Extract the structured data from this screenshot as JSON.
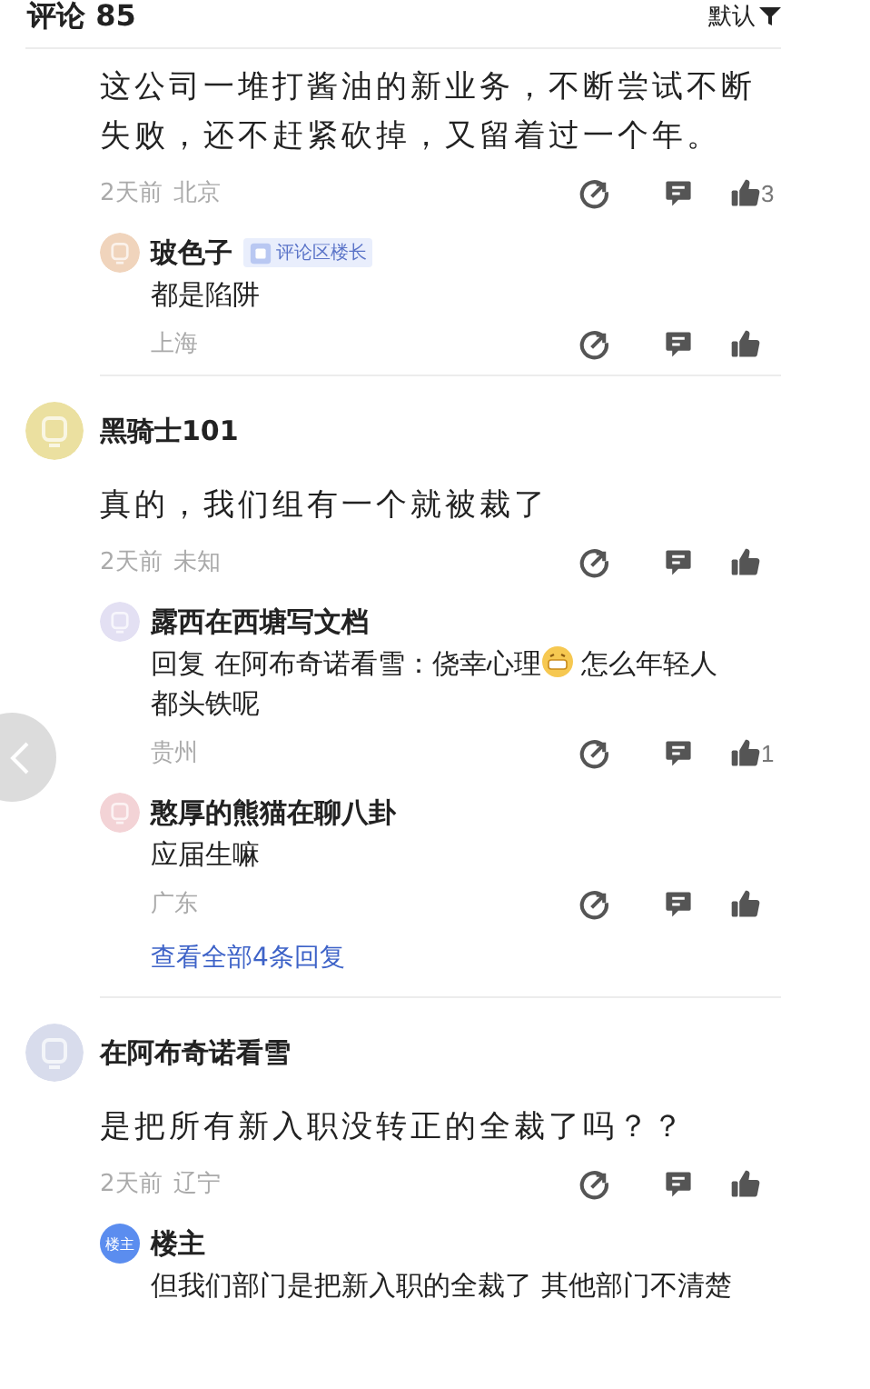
{
  "header": {
    "title": "评论 85",
    "sort": "默认"
  },
  "comments": [
    {
      "body": "这公司一堆打酱油的新业务，不断尝试不断失败，还不赶紧砍掉，又留着过一个年。",
      "time": "2天前",
      "location": "北京",
      "likes": "3",
      "replies": [
        {
          "name": "玻色子",
          "avatar": {
            "color": "#f0d4bc",
            "kind": "glyph"
          },
          "badge": "评论区楼长",
          "body_before": "都是陷阱",
          "location": "上海"
        }
      ]
    },
    {
      "name": "黑骑士101",
      "avatar": {
        "color": "#ebe0a0",
        "kind": "glyph"
      },
      "body": "真的，我们组有一个就被裁了",
      "time": "2天前",
      "location": "未知",
      "replies": [
        {
          "name": "露西在西塘写文档",
          "avatar": {
            "color": "#e3e0f3",
            "kind": "glyph"
          },
          "body_before": "回复 在阿布奇诺看雪：侥幸心理",
          "emoji": true,
          "body_after": [
            "怎么年轻人",
            "都头铁呢"
          ],
          "location": "贵州",
          "likes": "1"
        },
        {
          "name": "憨厚的熊猫在聊八卦",
          "avatar": {
            "color": "#f3d3d6",
            "kind": "glyph"
          },
          "body_before": "应届生嘛",
          "location": "广东"
        }
      ],
      "more": "查看全部4条回复"
    },
    {
      "name": "在阿布奇诺看雪",
      "avatar": {
        "color": "#d8dcec",
        "kind": "glyph"
      },
      "body": "是把所有新入职没转正的全裁了吗？？",
      "time": "2天前",
      "location": "辽宁",
      "replies": [
        {
          "name": "楼主",
          "avatar": {
            "color": "#5b8def",
            "kind": "text",
            "text": "楼主"
          },
          "body_before": "但我们部门是把新入职的全裁了 其他部门不清楚"
        }
      ]
    }
  ]
}
